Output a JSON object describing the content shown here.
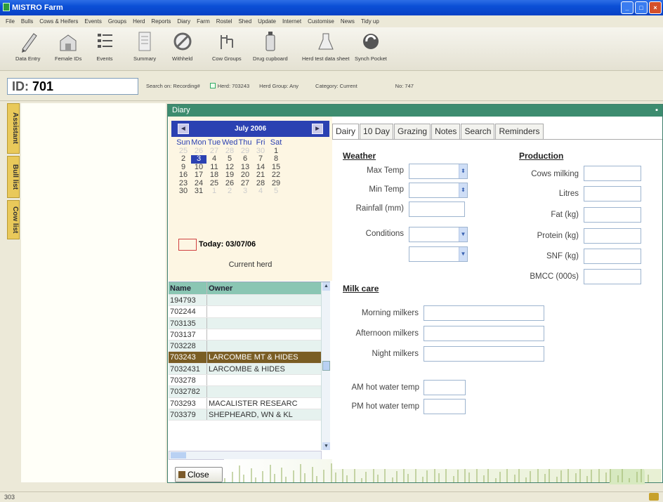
{
  "window": {
    "title": "MISTRO Farm"
  },
  "menu": [
    "File",
    "Bulls",
    "Cows & Heifers",
    "Events",
    "Groups",
    "Herd",
    "Reports",
    "Diary",
    "Farm",
    "Rostel",
    "Shed",
    "Update",
    "Internet",
    "Customise",
    "News",
    "Tidy up"
  ],
  "toolbar": [
    {
      "label": "Data Entry",
      "icon": "pencil-icon"
    },
    {
      "label": "Female IDs",
      "icon": "barn-icon"
    },
    {
      "label": "Events",
      "icon": "list-icon"
    },
    {
      "label": "Summary",
      "icon": "document-icon"
    },
    {
      "label": "Withheld",
      "icon": "prohibited-icon"
    },
    {
      "label": "Cow Groups",
      "icon": "cow-groups-icon"
    },
    {
      "label": "Drug cupboard",
      "icon": "bottle-icon"
    },
    {
      "label": "Herd test data sheet",
      "icon": "flask-icon"
    },
    {
      "label": "Synch Pocket",
      "icon": "sync-icon"
    }
  ],
  "idbar": {
    "id_label": "ID:",
    "id_value": "701",
    "search_on": "Search on: Recording#",
    "herd": "Herd: 703243",
    "herd_group": "Herd Group: Any",
    "category": "Category: Current",
    "no": "No: 747"
  },
  "sidetabs": [
    "Assistant",
    "Bull list",
    "Cow list"
  ],
  "diary": {
    "title": "Diary",
    "calendar": {
      "month": "July 2006",
      "days_header": [
        "Sun",
        "Mon",
        "Tue",
        "Wed",
        "Thu",
        "Fri",
        "Sat"
      ],
      "selected_day": "3",
      "today_label": "Today: 03/07/06",
      "current_herd": "Current herd"
    },
    "herd_table": {
      "headers": [
        "Name",
        "Owner"
      ],
      "rows": [
        [
          "194793",
          ""
        ],
        [
          "702244",
          ""
        ],
        [
          "703135",
          ""
        ],
        [
          "703137",
          ""
        ],
        [
          "703228",
          ""
        ],
        [
          "703243",
          "LARCOMBE MT & HIDES"
        ],
        [
          "7032431",
          "LARCOMBE & HIDES"
        ],
        [
          "703278",
          ""
        ],
        [
          "7032782",
          ""
        ],
        [
          "703293",
          "MACALISTER RESEARC"
        ],
        [
          "703379",
          "SHEPHEARD, WN & KL"
        ]
      ],
      "selected_row": 5
    },
    "close_label": "Close",
    "tabs": [
      "Dairy",
      "10 Day",
      "Grazing",
      "Notes",
      "Search",
      "Reminders"
    ],
    "active_tab": "Dairy",
    "weather": {
      "heading": "Weather",
      "max_temp": "Max Temp",
      "min_temp": "Min Temp",
      "rainfall": "Rainfall (mm)",
      "conditions": "Conditions"
    },
    "production": {
      "heading": "Production",
      "cows_milking": "Cows milking",
      "litres": "Litres",
      "fat": "Fat (kg)",
      "protein": "Protein (kg)",
      "snf": "SNF (kg)",
      "bmcc": "BMCC (000s)"
    },
    "milk_care": {
      "heading": "Milk care",
      "morning": "Morning milkers",
      "afternoon": "Afternoon milkers",
      "night": "Night milkers",
      "am_hot": "AM hot water temp",
      "pm_hot": "PM hot water temp"
    }
  },
  "status": {
    "text": "303"
  }
}
